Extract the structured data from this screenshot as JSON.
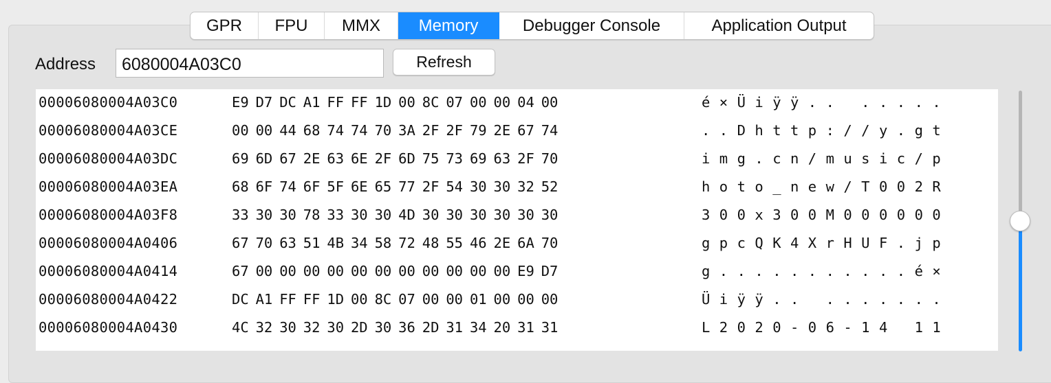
{
  "tabs": [
    {
      "label": "GPR",
      "active": false
    },
    {
      "label": "FPU",
      "active": false
    },
    {
      "label": "MMX",
      "active": false
    },
    {
      "label": "Memory",
      "active": true
    },
    {
      "label": "Debugger Console",
      "active": false
    },
    {
      "label": "Application Output",
      "active": false
    }
  ],
  "address": {
    "label": "Address",
    "value": "6080004A03C0",
    "refresh_label": "Refresh"
  },
  "memory": {
    "rows": [
      {
        "address": "00006080004A03C0",
        "bytes": [
          "E9",
          "D7",
          "DC",
          "A1",
          "FF",
          "FF",
          "1D",
          "00",
          "8C",
          "07",
          "00",
          "00",
          "04",
          "00"
        ],
        "ascii": [
          "é",
          "×",
          "Ü",
          "i",
          "ÿ",
          "ÿ",
          ".",
          ".",
          " ",
          ".",
          ".",
          ".",
          ".",
          "."
        ]
      },
      {
        "address": "00006080004A03CE",
        "bytes": [
          "00",
          "00",
          "44",
          "68",
          "74",
          "74",
          "70",
          "3A",
          "2F",
          "2F",
          "79",
          "2E",
          "67",
          "74"
        ],
        "ascii": [
          ".",
          ".",
          "D",
          "h",
          "t",
          "t",
          "p",
          ":",
          "/",
          "/",
          "y",
          ".",
          "g",
          "t"
        ]
      },
      {
        "address": "00006080004A03DC",
        "bytes": [
          "69",
          "6D",
          "67",
          "2E",
          "63",
          "6E",
          "2F",
          "6D",
          "75",
          "73",
          "69",
          "63",
          "2F",
          "70"
        ],
        "ascii": [
          "i",
          "m",
          "g",
          ".",
          "c",
          "n",
          "/",
          "m",
          "u",
          "s",
          "i",
          "c",
          "/",
          "p"
        ]
      },
      {
        "address": "00006080004A03EA",
        "bytes": [
          "68",
          "6F",
          "74",
          "6F",
          "5F",
          "6E",
          "65",
          "77",
          "2F",
          "54",
          "30",
          "30",
          "32",
          "52"
        ],
        "ascii": [
          "h",
          "o",
          "t",
          "o",
          "_",
          "n",
          "e",
          "w",
          "/",
          "T",
          "0",
          "0",
          "2",
          "R"
        ]
      },
      {
        "address": "00006080004A03F8",
        "bytes": [
          "33",
          "30",
          "30",
          "78",
          "33",
          "30",
          "30",
          "4D",
          "30",
          "30",
          "30",
          "30",
          "30",
          "30"
        ],
        "ascii": [
          "3",
          "0",
          "0",
          "x",
          "3",
          "0",
          "0",
          "M",
          "0",
          "0",
          "0",
          "0",
          "0",
          "0"
        ]
      },
      {
        "address": "00006080004A0406",
        "bytes": [
          "67",
          "70",
          "63",
          "51",
          "4B",
          "34",
          "58",
          "72",
          "48",
          "55",
          "46",
          "2E",
          "6A",
          "70"
        ],
        "ascii": [
          "g",
          "p",
          "c",
          "Q",
          "K",
          "4",
          "X",
          "r",
          "H",
          "U",
          "F",
          ".",
          "j",
          "p"
        ]
      },
      {
        "address": "00006080004A0414",
        "bytes": [
          "67",
          "00",
          "00",
          "00",
          "00",
          "00",
          "00",
          "00",
          "00",
          "00",
          "00",
          "00",
          "E9",
          "D7"
        ],
        "ascii": [
          "g",
          ".",
          ".",
          ".",
          ".",
          ".",
          ".",
          ".",
          ".",
          ".",
          ".",
          ".",
          "é",
          "×"
        ]
      },
      {
        "address": "00006080004A0422",
        "bytes": [
          "DC",
          "A1",
          "FF",
          "FF",
          "1D",
          "00",
          "8C",
          "07",
          "00",
          "00",
          "01",
          "00",
          "00",
          "00"
        ],
        "ascii": [
          "Ü",
          "i",
          "ÿ",
          "ÿ",
          ".",
          ".",
          " ",
          ".",
          ".",
          ".",
          ".",
          ".",
          ".",
          "."
        ]
      },
      {
        "address": "00006080004A0430",
        "bytes": [
          "4C",
          "32",
          "30",
          "32",
          "30",
          "2D",
          "30",
          "36",
          "2D",
          "31",
          "34",
          "20",
          "31",
          "31"
        ],
        "ascii": [
          "L",
          "2",
          "0",
          "2",
          "0",
          "-",
          "0",
          "6",
          "-",
          "1",
          "4",
          " ",
          "1",
          "1"
        ]
      }
    ]
  },
  "scroll_slider": {
    "position_fraction": 0.5,
    "fill_color": "#1a8cff"
  },
  "colors": {
    "accent": "#1a8cff",
    "panel_bg": "#e3e3e3",
    "window_bg": "#ececec"
  }
}
